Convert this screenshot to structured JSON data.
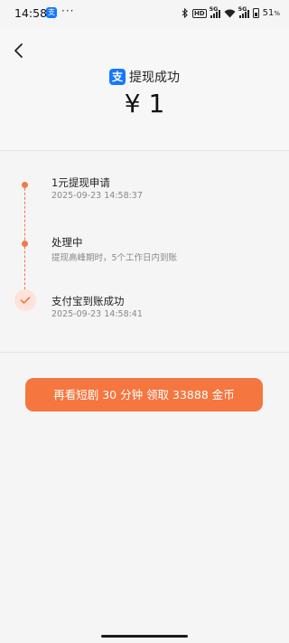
{
  "status_bar": {
    "time": "14:58",
    "notification_icon_text": "支",
    "more": "···",
    "hd": "HD",
    "net1": "5G",
    "net2": "5G",
    "battery": "51",
    "battery_unit": "%"
  },
  "header": {
    "title": "提现成功",
    "amount": "¥ 1",
    "logo_text": "支"
  },
  "timeline": {
    "steps": [
      {
        "title": "1元提现申请",
        "subtitle": "2025-09-23 14:58:37"
      },
      {
        "title": "处理中",
        "subtitle": "提现高峰期时，5个工作日内到账"
      },
      {
        "title": "支付宝到账成功",
        "subtitle": "2025-09-23 14:58:41"
      }
    ]
  },
  "action": {
    "label": "再看短剧 30 分钟 领取 33888 金币"
  },
  "colors": {
    "accent": "#f5763f",
    "timeline": "#f07a4a",
    "alipay": "#1677ff"
  }
}
